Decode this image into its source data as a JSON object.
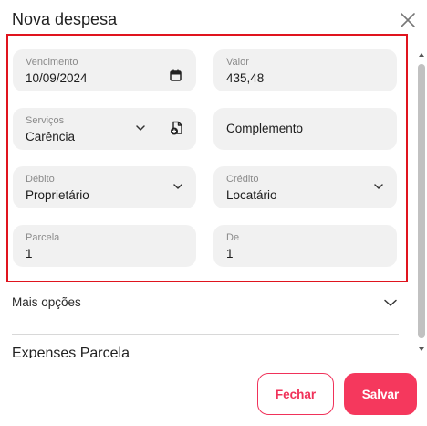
{
  "modal": {
    "title": "Nova despesa",
    "close_icon": "close-icon"
  },
  "form": {
    "vencimento": {
      "label": "Vencimento",
      "value": "10/09/2024",
      "icon": "calendar-icon"
    },
    "valor": {
      "label": "Valor",
      "value": "435,48"
    },
    "servicos": {
      "label": "Serviços",
      "value": "Carência",
      "icon": "chevron-down-icon",
      "extra_icon": "file-add-icon"
    },
    "complemento": {
      "placeholder": "Complemento"
    },
    "debito": {
      "label": "Débito",
      "value": "Proprietário",
      "icon": "chevron-down-icon"
    },
    "credito": {
      "label": "Crédito",
      "value": "Locatário",
      "icon": "chevron-down-icon"
    },
    "parcela": {
      "label": "Parcela",
      "value": "1"
    },
    "de": {
      "label": "De",
      "value": "1"
    }
  },
  "mais_opcoes": {
    "label": "Mais opções",
    "icon": "chevron-down-icon"
  },
  "section": {
    "heading": "Expenses Parcela"
  },
  "footer": {
    "fechar_label": "Fechar",
    "salvar_label": "Salvar"
  },
  "colors": {
    "accent": "#f5385d",
    "highlight_border": "#e0141e",
    "field_bg": "#f1f1f1"
  }
}
